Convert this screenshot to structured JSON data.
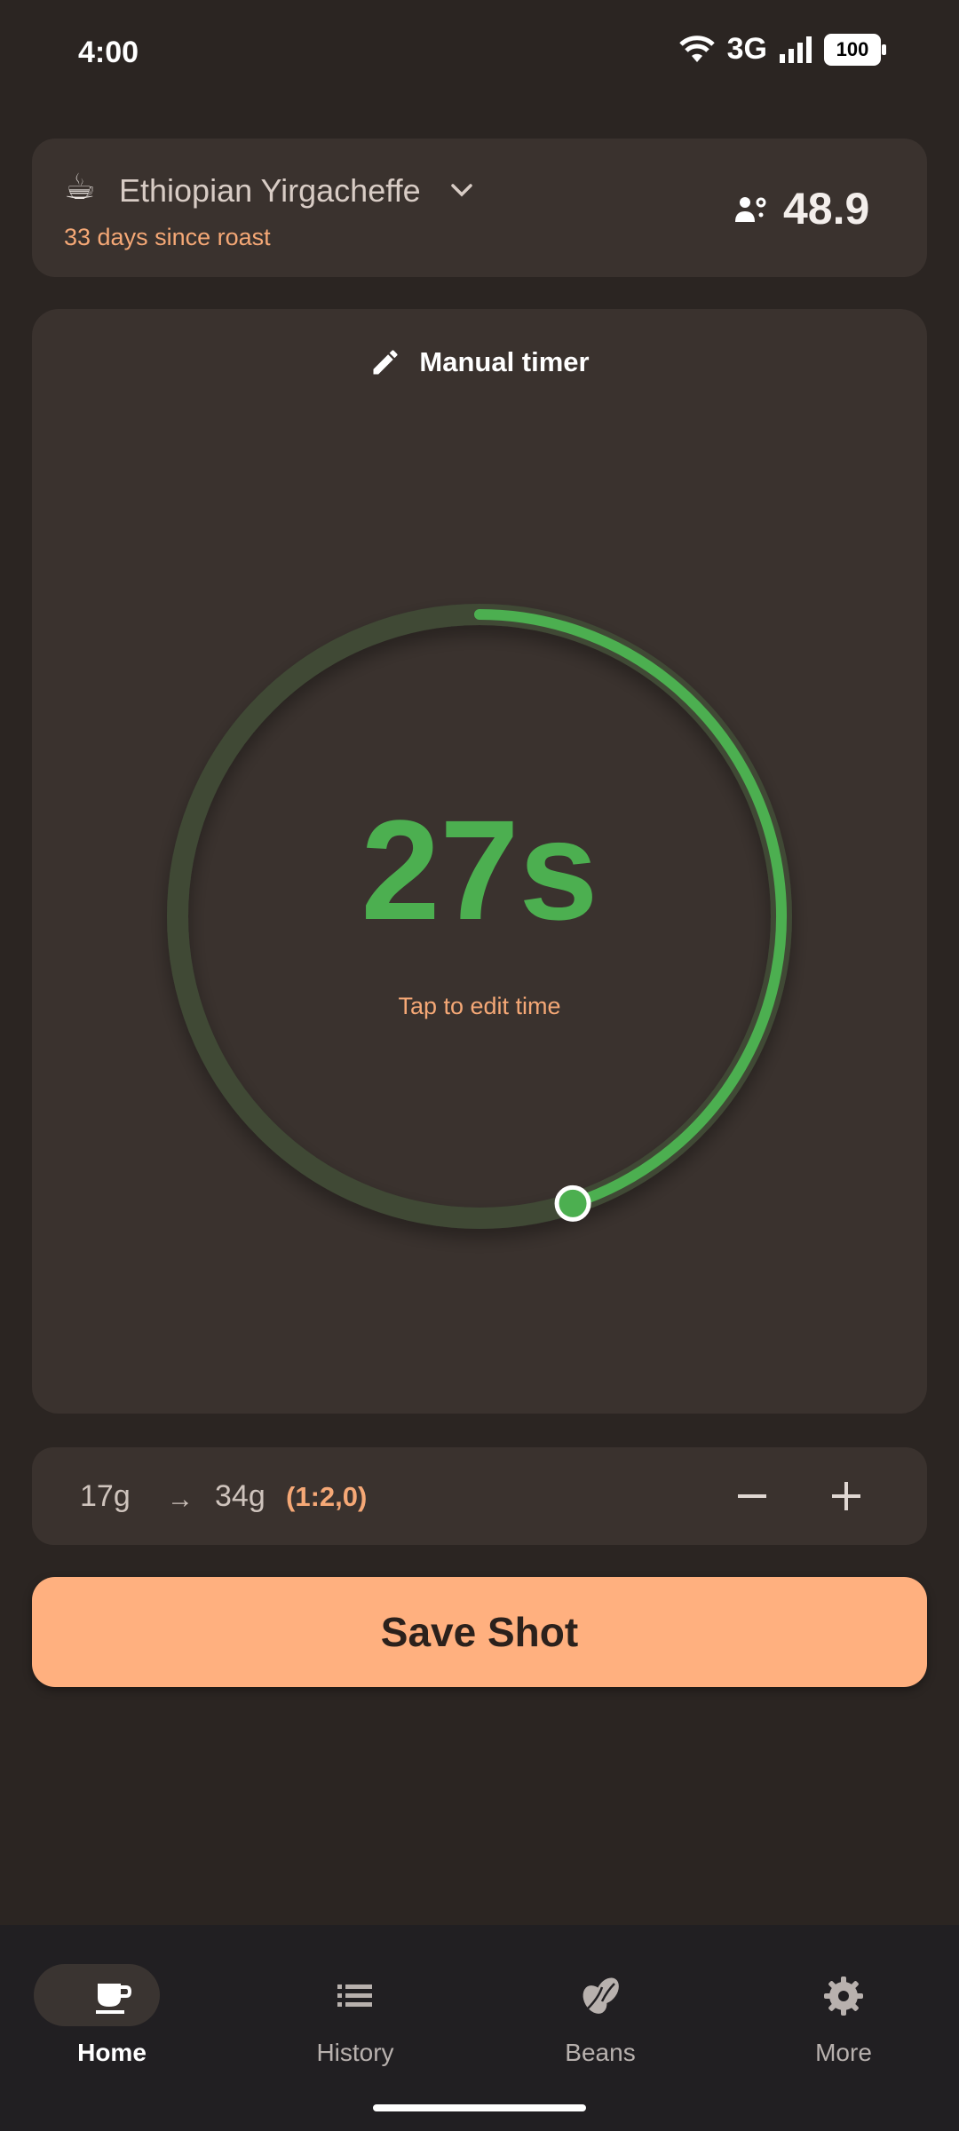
{
  "status_bar": {
    "time": "4:00",
    "network": "3G",
    "battery": "100"
  },
  "bean": {
    "emoji": "☕",
    "name": "Ethiopian Yirgacheffe",
    "roast_info": "33 days since roast",
    "grind_setting": "48.9"
  },
  "timer": {
    "mode_label": "Manual timer",
    "time_display": "27s",
    "hint": "Tap to edit time",
    "progress_fraction": 0.45,
    "colors": {
      "track": "#3f4a36",
      "progress": "#4caf50"
    }
  },
  "dose": {
    "dose_in": "17g",
    "arrow": "→",
    "dose_out": "34g",
    "ratio": "(1:2,0)"
  },
  "actions": {
    "save_label": "Save Shot"
  },
  "nav": {
    "items": [
      {
        "label": "Home",
        "icon": "coffee-cup-icon",
        "active": true
      },
      {
        "label": "History",
        "icon": "list-icon",
        "active": false
      },
      {
        "label": "Beans",
        "icon": "coffee-bean-icon",
        "active": false
      },
      {
        "label": "More",
        "icon": "gear-icon",
        "active": false
      }
    ]
  },
  "colors": {
    "accent": "#ffb07f",
    "roast_text": "#f5a876",
    "timer_green": "#4caf50"
  }
}
